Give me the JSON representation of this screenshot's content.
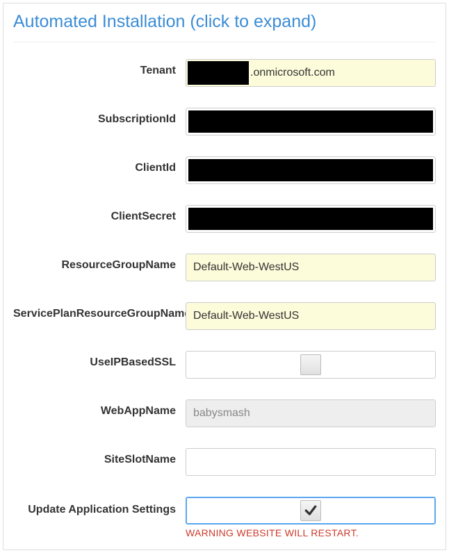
{
  "title": "Automated Installation (click to expand)",
  "warning": "WARNING WEBSITE WILL RESTART.",
  "fields": {
    "tenant": {
      "label": "Tenant",
      "suffix": ".onmicrosoft.com"
    },
    "subscriptionId": {
      "label": "SubscriptionId"
    },
    "clientId": {
      "label": "ClientId"
    },
    "clientSecret": {
      "label": "ClientSecret"
    },
    "resourceGroupName": {
      "label": "ResourceGroupName",
      "value": "Default-Web-WestUS"
    },
    "servicePlanResourceGroupName": {
      "label": "ServicePlanResourceGroupName",
      "value": "Default-Web-WestUS"
    },
    "useIpBasedSsl": {
      "label": "UseIPBasedSSL",
      "checked": false
    },
    "webAppName": {
      "label": "WebAppName",
      "value": "babysmash"
    },
    "siteSlotName": {
      "label": "SiteSlotName",
      "value": ""
    },
    "updateAppSettings": {
      "label": "Update Application Settings",
      "checked": true
    }
  }
}
